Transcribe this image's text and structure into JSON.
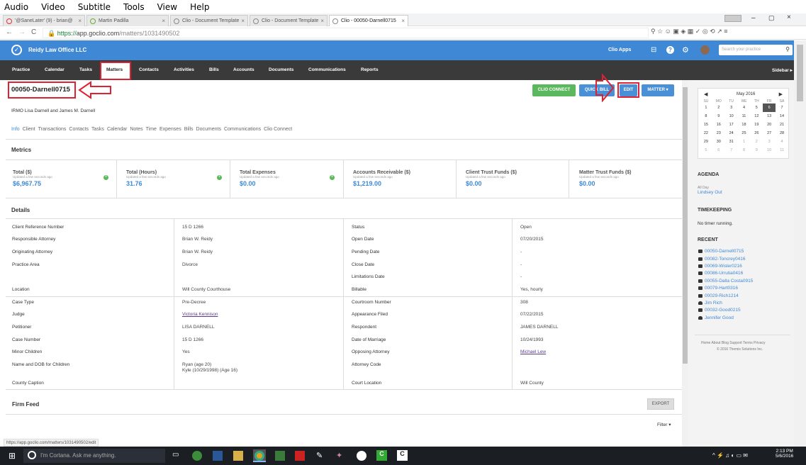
{
  "app_menu": [
    "Audio",
    "Video",
    "Subtitle",
    "Tools",
    "View",
    "Help"
  ],
  "tabs": [
    "'@SaneLater' (9) - brian@",
    "Martin Padilla",
    "Clio - Document Template",
    "Clio - Document Template",
    "Clio - 00050-Darnell0715"
  ],
  "url": {
    "scheme": "https://",
    "host": "app.goclio.com",
    "path": "/matters/1031490502"
  },
  "header": {
    "firm": "Reidy Law Office LLC",
    "clio_apps": "Clio Apps",
    "search_placeholder": "Search your practice"
  },
  "nav": [
    "Practice",
    "Calendar",
    "Tasks",
    "Matters",
    "Contacts",
    "Activities",
    "Bills",
    "Accounts",
    "Documents",
    "Communications",
    "Reports"
  ],
  "nav_right": "Sidebar ▸",
  "matter": {
    "title": "00050-Darnell0715",
    "description": "IRMO Lisa Darnell and James M. Darnell"
  },
  "buttons": {
    "clio_connect": "CLIO CONNECT",
    "quick_bill": "QUICK BILL",
    "edit": "EDIT",
    "matter": "MATTER ▾"
  },
  "subtabs": [
    "Info",
    "Client",
    "Transactions",
    "Contacts",
    "Tasks",
    "Calendar",
    "Notes",
    "Time",
    "Expenses",
    "Bills",
    "Documents",
    "Communications",
    "Clio Connect"
  ],
  "metrics_title": "Metrics",
  "metrics": [
    {
      "title": "Total ($)",
      "updated": "Updated a few seconds ago",
      "value": "$6,967.75"
    },
    {
      "title": "Total (Hours)",
      "updated": "Updated a few seconds ago",
      "value": "31.76"
    },
    {
      "title": "Total Expenses",
      "updated": "Updated a few seconds ago",
      "value": "$0.00"
    },
    {
      "title": "Accounts Receivable ($)",
      "updated": "Updated a few seconds ago",
      "value": "$1,219.00"
    },
    {
      "title": "Client Trust Funds ($)",
      "updated": "Updated a few seconds ago",
      "value": "$0.00"
    },
    {
      "title": "Matter Trust Funds ($)",
      "updated": "Updated a few seconds ago",
      "value": "$0.00"
    }
  ],
  "details_title": "Details",
  "details_left": [
    [
      "Client Reference Number",
      "15 D 1266"
    ],
    [
      "Responsible Attorney",
      "Brian W. Reidy"
    ],
    [
      "Originating Attorney",
      "Brian W. Reidy"
    ],
    [
      "Practice Area",
      "Divorce"
    ],
    [
      "Location",
      "Will County Courthouse"
    ],
    [
      "Case Type",
      "Pre-Decree"
    ],
    [
      "Judge",
      "Victoria Kennison"
    ],
    [
      "Petitioner",
      "LISA DARNELL"
    ],
    [
      "Case Number",
      "15 D 1266"
    ],
    [
      "Minor Children",
      "Yes"
    ],
    [
      "Name and DOB for Children",
      "Ryan (age 20)"
    ],
    [
      "County Caption",
      ""
    ]
  ],
  "children_line2": "Kyle (10/29/1998) (Age 16)",
  "details_right": [
    [
      "Status",
      "Open"
    ],
    [
      "Open Date",
      "07/20/2015"
    ],
    [
      "Pending Date",
      "-"
    ],
    [
      "Close Date",
      "-"
    ],
    [
      "Limitations Date",
      "-"
    ],
    [
      "Billable",
      "Yes, hourly"
    ],
    [
      "Courtroom Number",
      "308"
    ],
    [
      "Appearance Filed",
      "07/22/2015"
    ],
    [
      "Respondent",
      "JAMES DARNELL"
    ],
    [
      "Date of Marriage",
      "10/24/1993"
    ],
    [
      "Opposing Attorney",
      "Michael Lew"
    ],
    [
      "Attorney Code",
      ""
    ],
    [
      "Court Location",
      "Will County"
    ]
  ],
  "firm_feed": "Firm Feed",
  "export": "EXPORT",
  "filter": "Filter ▾",
  "calendar": {
    "month": "May 2016",
    "days": [
      "SU",
      "MO",
      "TU",
      "WE",
      "TH",
      "FR",
      "SA"
    ],
    "weeks": [
      [
        "1",
        "2",
        "3",
        "4",
        "5",
        "6",
        "7"
      ],
      [
        "8",
        "9",
        "10",
        "11",
        "12",
        "13",
        "14"
      ],
      [
        "15",
        "16",
        "17",
        "18",
        "19",
        "20",
        "21"
      ],
      [
        "22",
        "23",
        "24",
        "25",
        "26",
        "27",
        "28"
      ],
      [
        "29",
        "30",
        "31",
        "1",
        "2",
        "3",
        "4"
      ],
      [
        "5",
        "6",
        "7",
        "8",
        "9",
        "10",
        "11"
      ]
    ]
  },
  "agenda": {
    "title": "AGENDA",
    "all_day": "All Day",
    "event": "Lindsey Out"
  },
  "timekeeping": {
    "title": "TIMEKEEPING",
    "text": "No timer running."
  },
  "recent": {
    "title": "RECENT",
    "items": [
      "00050-Darnell0715",
      "00082-Toncrey0416",
      "00069-Wisler0216",
      "00086-Urrutia0416",
      "00055-Dalla Costa0915",
      "00079-Hart0316",
      "00029-Rich1214",
      "Jim Rich",
      "00032-Good0215",
      "Jennifer Good"
    ]
  },
  "footer": {
    "links": "Home  About  Blog  Support  Terms  Privacy",
    "copy": "© 2016 Themis Solutions Inc."
  },
  "status_url": "https://app.goclio.com/matters/1031490502/edit",
  "taskbar": {
    "cortana": "I'm Cortana. Ask me anything.",
    "time": "2:13 PM",
    "date": "5/6/2016"
  }
}
